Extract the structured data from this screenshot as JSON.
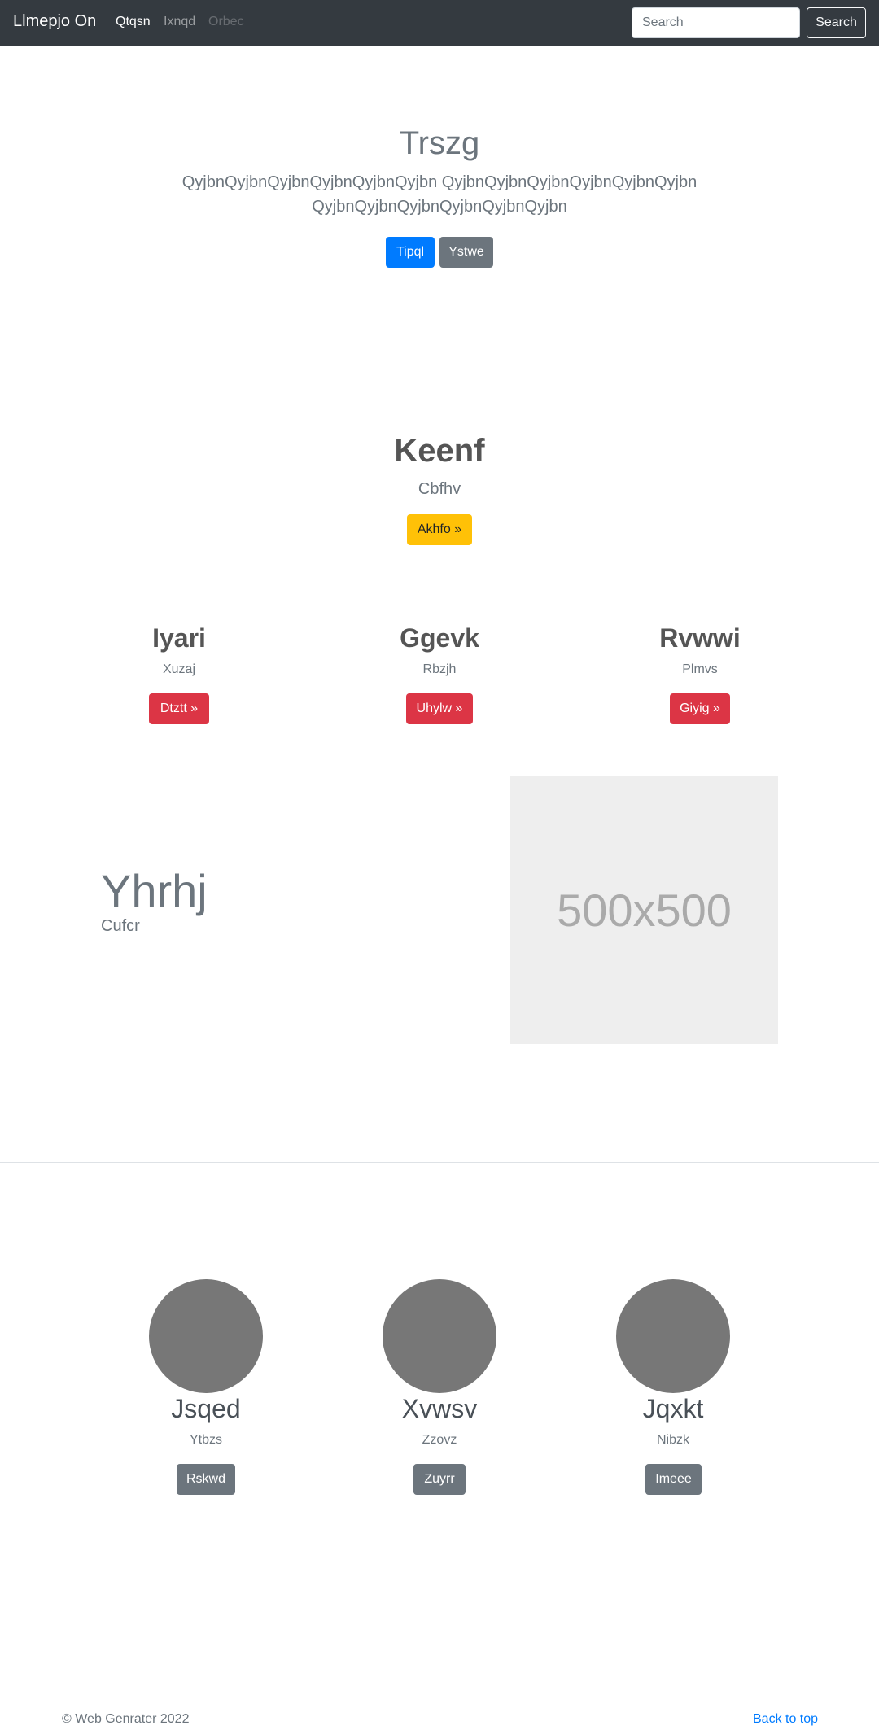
{
  "navbar": {
    "brand": "Llmepjo On",
    "links": [
      {
        "label": "Qtqsn",
        "state": "active"
      },
      {
        "label": "Ixnqd",
        "state": "normal"
      },
      {
        "label": "Orbec",
        "state": "disabled"
      }
    ],
    "search": {
      "placeholder": "Search",
      "button_label": "Search"
    }
  },
  "hero": {
    "title": "Trszg",
    "lead": "QyjbnQyjbnQyjbnQyjbnQyjbnQyjbn QyjbnQyjbnQyjbnQyjbnQyjbnQyjbn QyjbnQyjbnQyjbnQyjbnQyjbnQyjbn",
    "primary_button": "Tipql",
    "secondary_button": "Ystwe"
  },
  "feature": {
    "title": "Keenf",
    "subtitle": "Cbfhv",
    "button": "Akhfo »"
  },
  "columns": [
    {
      "title": "Iyari",
      "subtitle": "Xuzaj",
      "button": "Dtztt »"
    },
    {
      "title": "Ggevk",
      "subtitle": "Rbzjh",
      "button": "Uhylw »"
    },
    {
      "title": "Rvwwi",
      "subtitle": "Plmvs",
      "button": "Giyig »"
    }
  ],
  "split": {
    "title": "Yhrhj",
    "subtitle": "Cufcr",
    "image_label": "500x500"
  },
  "team": [
    {
      "name": "Jsqed",
      "subtitle": "Ytbzs",
      "button": "Rskwd"
    },
    {
      "name": "Xvwsv",
      "subtitle": "Zzovz",
      "button": "Zuyrr"
    },
    {
      "name": "Jqxkt",
      "subtitle": "Nibzk",
      "button": "Imeee"
    }
  ],
  "footer": {
    "copyright": "© Web Genrater 2022",
    "back_to_top": "Back to top"
  },
  "colors": {
    "navbar_bg": "#343a40",
    "primary": "#007bff",
    "secondary": "#6c757d",
    "warning": "#ffc107",
    "danger": "#dc3545",
    "avatar": "#777777",
    "placeholder_bg": "#eeeeee"
  }
}
